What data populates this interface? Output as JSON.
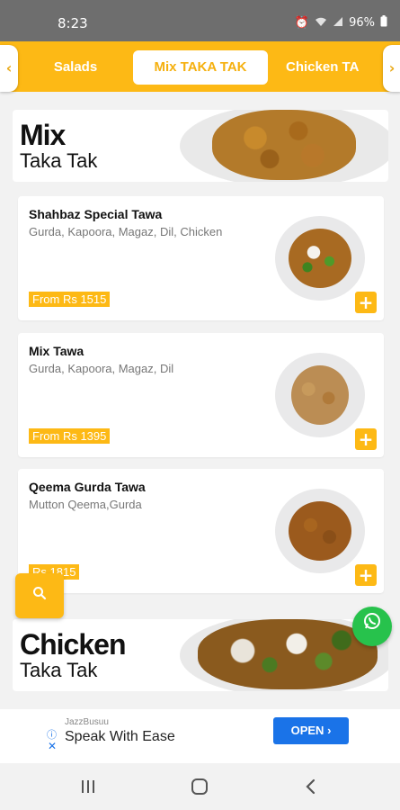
{
  "status": {
    "time": "8:23",
    "battery": "96%"
  },
  "tabs": [
    {
      "label": "Salads"
    },
    {
      "label": "Mix TAKA TAK"
    },
    {
      "label": "Chicken TA"
    }
  ],
  "nav_arrows": {
    "left": "‹",
    "right": "›"
  },
  "categories": [
    {
      "title": "Mix",
      "subtitle": "Taka Tak"
    },
    {
      "title": "Chicken",
      "subtitle": "Taka Tak"
    }
  ],
  "items": [
    {
      "name": "Shahbaz Special Tawa",
      "desc": "Gurda, Kapoora, Magaz, Dil, Chicken",
      "price": "From Rs 1515"
    },
    {
      "name": "Mix Tawa",
      "desc": "Gurda, Kapoora, Magaz, Dil",
      "price": "From Rs 1395"
    },
    {
      "name": "Qeema Gurda Tawa",
      "desc": "Mutton Qeema,Gurda",
      "price": "Rs 1815"
    }
  ],
  "add_label": "+",
  "ad": {
    "brand": "JazzBusuu",
    "title": "Speak With Ease",
    "button": "OPEN"
  },
  "icons": {
    "search": "search-icon",
    "whatsapp": "whatsapp-icon",
    "add": "plus-icon",
    "back": "back-nav-icon",
    "home": "home-nav-icon",
    "recents": "recents-nav-icon"
  },
  "colors": {
    "accent": "#fdb915",
    "whatsapp": "#27c24c",
    "ad_button": "#1a73e8"
  }
}
